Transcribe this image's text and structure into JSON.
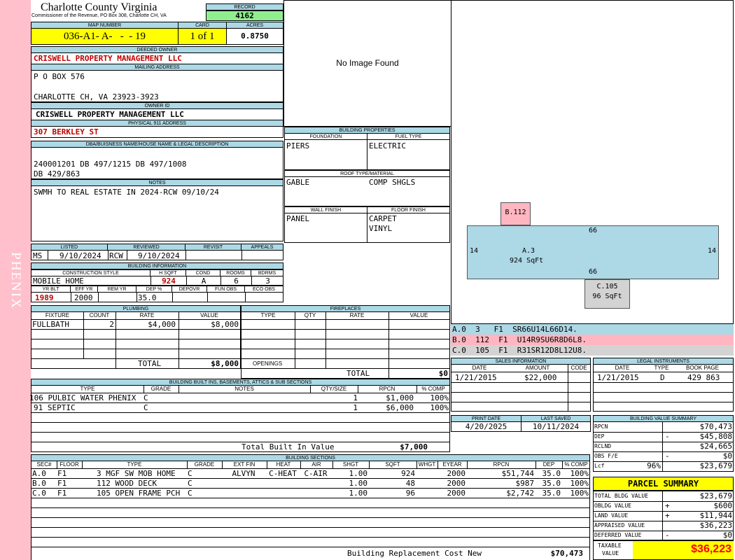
{
  "side_label": "PHENIX",
  "header": {
    "county": "Charlotte County Virginia",
    "commissioner": "Commissioner of the Revenue, PO Box 308, Charlotte CH, VA",
    "record_label": "RECORD",
    "record": "4162",
    "map_number_label": "MAP NUMBER",
    "map_number": "036-A1- A-   -  - 19",
    "card_label": "CARD",
    "card": "1 of 1",
    "acres_label": "ACRES",
    "acres": "0.8750"
  },
  "owner": {
    "deeded_owner_label": "DEEDED OWNER",
    "deeded_owner": "CRISWELL PROPERTY MANAGEMENT LLC",
    "mailing_label": "MAILING ADDRESS",
    "mailing_line1": "P O BOX 576",
    "mailing_line2": "CHARLOTTE CH, VA 23923-3923",
    "owner_id_label": "OWNER ID",
    "owner_id": "CRISWELL PROPERTY MANAGEMENT LLC",
    "physical_label": "PHYSICAL 911 ADDRESS",
    "physical": "307 BERKLEY ST",
    "dba_label": "DBA/BUISNESS NAME/HOUSE NAME & LEGAL DESCRIPTION",
    "legal_line1": "240001201 DB 497/1215 DB 497/1008",
    "legal_line2": "DB 429/863",
    "notes_label": "NOTES",
    "notes": "SWMH TO REAL ESTATE IN 2024-RCW 09/10/24"
  },
  "image_placeholder": "No Image Found",
  "building_props": {
    "title": "BUILDING PROPERTIES",
    "foundation_label": "FOUNDATION",
    "foundation": "PIERS",
    "fuel_label": "FUEL TYPE",
    "fuel": "ELECTRIC",
    "roof_label": "ROOF TYPE/MATERIAL",
    "roof_type": "GABLE",
    "roof_material": "COMP SHGLS",
    "wall_label": "WALL FINISH",
    "wall": "PANEL",
    "floor_label": "FLOOR FINISH",
    "floor1": "CARPET",
    "floor2": "VINYL"
  },
  "sketch": {
    "a_label": "A.3",
    "a_area": "924 SqFt",
    "a_top": "66",
    "a_bottom": "66",
    "a_left": "14",
    "a_right": "14",
    "b_label": "B.112",
    "c_label": "C.105",
    "c_area": "96 SqFt",
    "legend": [
      {
        "text": "A.0  3   F1  SR66U14L66D14.",
        "color": "#add8e6"
      },
      {
        "text": "B.0  112  F1  U14R9SU6R8D6L8.",
        "color": "#ffb6c1"
      },
      {
        "text": "C.0  105  F1  R31SR12D8L12U8.",
        "color": "#d3d3d3"
      }
    ]
  },
  "listing": {
    "listed_label": "LISTED",
    "reviewed_label": "REVIEWED",
    "revisit_label": "REVISIT",
    "appeals_label": "APPEALS",
    "listed_by": "MS",
    "listed_date": "9/10/2024",
    "reviewed_by": "RCW",
    "reviewed_date": "9/10/2024"
  },
  "building_info": {
    "title": "BUILDING INFORMATION",
    "style_label": "CONSTRUCTION STYLE",
    "hsqft_label": "H SQFT",
    "cond_label": "COND",
    "rooms_label": "ROOMS",
    "bdrms_label": "BDRMS",
    "style": "MOBILE HOME",
    "hsqft": "924",
    "cond": "A",
    "rooms": "6",
    "bdrms": "3",
    "yrblt_label": "YR BLT",
    "effyr_label": "EFF YR",
    "remyr_label": "REM YR",
    "dep_label": "DEP %",
    "depovr_label": "DEPOVR",
    "funobs_label": "FUN OBS",
    "ecoobs_label": "ECO OBS",
    "yrblt": "1989",
    "effyr": "2000",
    "dep": "35.0"
  },
  "plumbing": {
    "title": "PLUMBING",
    "headers": [
      "FIXTURE",
      "COUNT",
      "RATE",
      "VALUE"
    ],
    "rows": [
      {
        "fixture": "FULLBATH",
        "count": "2",
        "rate": "$4,000",
        "value": "$8,000"
      }
    ],
    "total_label": "TOTAL",
    "total": "$8,000"
  },
  "fireplaces": {
    "title": "FIREPLACES",
    "headers": [
      "TYPE",
      "QTY",
      "RATE",
      "VALUE"
    ],
    "openings_label": "OPENINGS",
    "total_label": "TOTAL",
    "total": "$0"
  },
  "builtins": {
    "title": "BUILDING BUILT INS, BASEMENTS, ATTICS & SUB SECTIONS",
    "headers": [
      "TYPE",
      "GRADE",
      "NOTES",
      "QTY/SIZE",
      "RPCN",
      "% COMP"
    ],
    "rows": [
      {
        "type": "106 PULBIC WATER PHENIX",
        "grade": "C",
        "qty": "1",
        "rpcn": "$1,000",
        "comp": "100%"
      },
      {
        "type": "91 SEPTIC",
        "grade": "C",
        "qty": "1",
        "rpcn": "$6,000",
        "comp": "100%"
      }
    ],
    "total_label": "Total Built In Value",
    "total": "$7,000"
  },
  "sections": {
    "title": "BUILDING SECTIONS",
    "headers": [
      "SEC#",
      "FLOOR",
      "TYPE",
      "GRADE",
      "EXT FIN",
      "HEAT",
      "AIR",
      "SHGT",
      "SQFT",
      "WHGT",
      "EYEAR",
      "RPCN",
      "DEP",
      "% COMP"
    ],
    "rows": [
      {
        "sec": "A.0",
        "floor": "F1",
        "type": "3 MGF SW MOB HOME",
        "grade": "C",
        "ext": "ALVYN",
        "heat": "C-HEAT",
        "air": "C-AIR",
        "shgt": "1.00",
        "sqft": "924",
        "whgt": "",
        "eyear": "2000",
        "rpcn": "$51,744",
        "dep": "35.0",
        "comp": "100%"
      },
      {
        "sec": "B.0",
        "floor": "F1",
        "type": "112 WOOD DECK",
        "grade": "C",
        "ext": "",
        "heat": "",
        "air": "",
        "shgt": "1.00",
        "sqft": "48",
        "whgt": "",
        "eyear": "2000",
        "rpcn": "$987",
        "dep": "35.0",
        "comp": "100%"
      },
      {
        "sec": "C.0",
        "floor": "F1",
        "type": "105 OPEN FRAME PCH",
        "grade": "C",
        "ext": "",
        "heat": "",
        "air": "",
        "shgt": "1.00",
        "sqft": "96",
        "whgt": "",
        "eyear": "2000",
        "rpcn": "$2,742",
        "dep": "35.0",
        "comp": "100%"
      }
    ],
    "total_label": "Building Replacement Cost New",
    "total": "$70,473"
  },
  "sales": {
    "title": "SALES INFORMATION",
    "headers": [
      "DATE",
      "AMOUNT",
      "CODE"
    ],
    "rows": [
      {
        "date": "1/21/2015",
        "amount": "$22,000",
        "code": ""
      }
    ]
  },
  "legal_instruments": {
    "title": "LEGAL INSTRUMENTS",
    "headers": [
      "DATE",
      "TYPE",
      "BOOK PAGE"
    ],
    "rows": [
      {
        "date": "1/21/2015",
        "type": "D",
        "book": "429 863"
      }
    ]
  },
  "print": {
    "print_label": "PRINT DATE",
    "saved_label": "LAST SAVED",
    "print_date": "4/20/2025",
    "saved_date": "10/11/2024"
  },
  "value_summary": {
    "title": "BUILDING VALUE SUMMARY",
    "rows": [
      {
        "label": "RPCN",
        "sign": "",
        "pct": "",
        "value": "$70,473"
      },
      {
        "label": "DEP",
        "sign": "-",
        "pct": "",
        "value": "$45,808"
      },
      {
        "label": "RCLND",
        "sign": "",
        "pct": "",
        "value": "$24,665"
      },
      {
        "label": "OBS F/E",
        "sign": "-",
        "pct": "",
        "value": "$0"
      },
      {
        "label": "Lcf",
        "sign": "",
        "pct": "96%",
        "value": "$23,679"
      }
    ]
  },
  "parcel": {
    "title": "PARCEL SUMMARY",
    "rows": [
      {
        "label": "TOTAL BLDG VALUE",
        "sign": "",
        "value": "$23,679"
      },
      {
        "label": "OBLDG VALUE",
        "sign": "+",
        "value": "$600"
      },
      {
        "label": "LAND VALUE",
        "sign": "+",
        "value": "$11,944"
      },
      {
        "label": "APPRAISED VALUE",
        "sign": "",
        "value": "$36,223"
      },
      {
        "label": "DEFERRED VALUE",
        "sign": "-",
        "value": "$0"
      }
    ],
    "taxable_label1": "TAXABLE",
    "taxable_label2": "VALUE",
    "taxable": "$36,223"
  },
  "colors": {
    "header_blue": "#add8e6",
    "side_pink": "#ffc0cb",
    "highlight_yellow": "#ffff00",
    "record_green": "#90ee90",
    "value_red": "#c00000"
  }
}
